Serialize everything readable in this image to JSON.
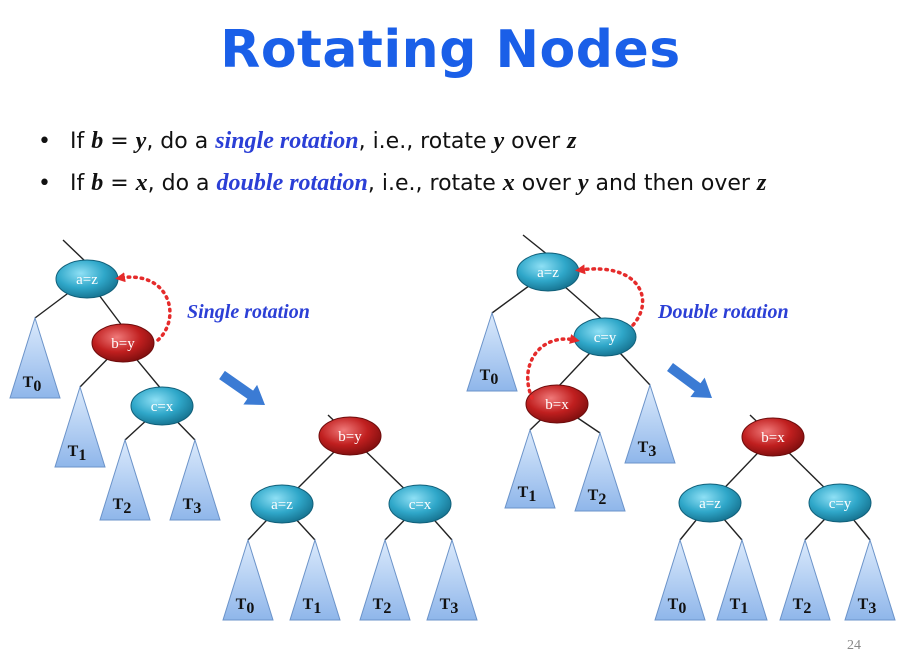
{
  "title": "Rotating Nodes",
  "bullets": [
    {
      "marker": "•",
      "p1": "If ",
      "v1": "b",
      "p2": " = ",
      "v2": "y",
      "p3": ", do a ",
      "em": "single rotation",
      "p4": ", i.e., rotate ",
      "v3": "y",
      "p5": " over ",
      "v4": "z",
      "p6": "",
      "v5": "",
      "p7": "",
      "v6": ""
    },
    {
      "marker": "•",
      "p1": "If ",
      "v1": "b",
      "p2": " = ",
      "v2": "x",
      "p3": ", do a ",
      "em": "double rotation",
      "p4": ", i.e., rotate ",
      "v3": "x",
      "p5": " over ",
      "v4": "y",
      "p6": " and then over ",
      "v5": "z"
    }
  ],
  "diagram": {
    "colors": {
      "blue_node": "#2fa7c9",
      "red_node": "#c01f1f",
      "triangle": "#9cc2ee",
      "arrow": "#3b7bd4",
      "dotted": "#e52b2b",
      "line": "#222222",
      "subtree_text": "#111111",
      "label": "#2b3fd6"
    },
    "single_label": "Single rotation",
    "double_label": "Double rotation",
    "nodes": {
      "a_z": "a=z",
      "b_y": "b=y",
      "c_x": "c=x",
      "c_y": "c=y",
      "b_x": "b=x"
    },
    "subtrees": {
      "T0": {
        "main": "T",
        "sub": "0"
      },
      "T1": {
        "main": "T",
        "sub": "1"
      },
      "T2": {
        "main": "T",
        "sub": "2"
      },
      "T3": {
        "main": "T",
        "sub": "3"
      }
    }
  },
  "page_number": "24"
}
